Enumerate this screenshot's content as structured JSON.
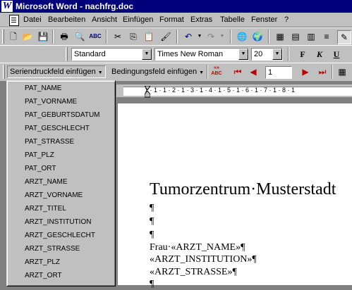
{
  "title": "Microsoft Word - nachfrg.doc",
  "menu": [
    "Datei",
    "Bearbeiten",
    "Ansicht",
    "Einfügen",
    "Format",
    "Extras",
    "Tabelle",
    "Fenster",
    "?"
  ],
  "format_bar": {
    "style": "Standard",
    "font": "Times New Roman",
    "size": "20",
    "bold": "F",
    "italic": "K",
    "underline": "U"
  },
  "mailmerge_bar": {
    "insert_field": "Seriendruckfeld einfügen",
    "condition_field": "Bedingungsfeld einfügen",
    "abc_label": "«»\nABC",
    "record": "1"
  },
  "fields": [
    "PAT_NAME",
    "PAT_VORNAME",
    "PAT_GEBURTSDATUM",
    "PAT_GESCHLECHT",
    "PAT_STRASSE",
    "PAT_PLZ",
    "PAT_ORT",
    "ARZT_NAME",
    "ARZT_VORNAME",
    "ARZT_TITEL",
    "ARZT_INSTITUTION",
    "ARZT_GESCHLECHT",
    "ARZT_STRASSE",
    "ARZT_PLZ",
    "ARZT_ORT"
  ],
  "ruler_text": "1 · 1 · 1 · 2 · 1 · 3 · 1 · 4 · 1 · 5 · 1 · 6 · 1 · 7 · 1 · 8 · 1",
  "document": {
    "heading": "Tumorzentrum·Musterstadt",
    "para1": "¶",
    "para2": "¶",
    "para3": "¶",
    "line_frau": "Frau·«ARZT_NAME»¶",
    "line_inst": "«ARZT_INSTITUTION»¶",
    "line_str": "«ARZT_STRASSE»¶",
    "line_last": "¶"
  }
}
